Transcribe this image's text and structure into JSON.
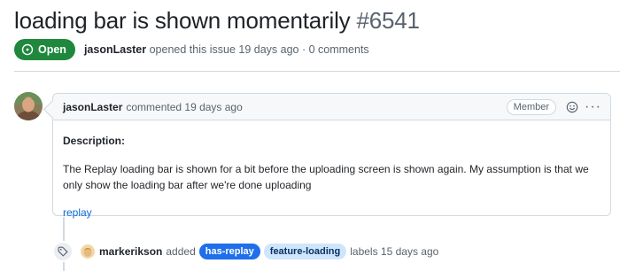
{
  "issue": {
    "title": "loading bar is shown momentarily",
    "number": "#6541",
    "state": "Open",
    "author": "jasonLaster",
    "opened_text": "opened this issue 19 days ago · 0 comments"
  },
  "comment": {
    "author": "jasonLaster",
    "time": "commented 19 days ago",
    "role": "Member",
    "heading": "Description:",
    "paragraph": "The Replay loading bar is shown for a bit before the uploading screen is shown again. My assumption is that we only show the loading bar after we're done uploading",
    "link": "replay"
  },
  "event": {
    "actor": "markerikson",
    "verb": "added",
    "labels": [
      "has-replay",
      "feature-loading"
    ],
    "tail": "labels 15 days ago"
  },
  "icons": {
    "state": "issue-opened-icon",
    "emoji": "smiley-icon",
    "more": "kebab-horizontal-icon",
    "event": "tag-icon"
  },
  "colors": {
    "open_green": "#1f883d",
    "link_blue": "#0969da",
    "label_has_replay": "#1f6feb",
    "label_feature_loading": "#cfe6fa"
  }
}
